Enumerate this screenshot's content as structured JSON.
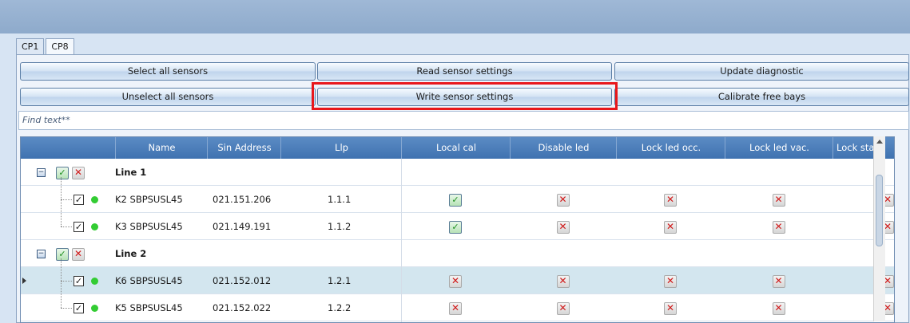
{
  "tabs": [
    {
      "label": "CP1",
      "active": false
    },
    {
      "label": "CP8",
      "active": true
    }
  ],
  "toolbar": {
    "select_all": "Select all sensors",
    "unselect_all": "Unselect all sensors",
    "read_settings": "Read sensor settings",
    "write_settings": "Write sensor settings",
    "update_diagnostic": "Update diagnostic",
    "calibrate": "Calibrate free bays"
  },
  "search": {
    "placeholder": "Find text**"
  },
  "columns": [
    "Name",
    "Sin Address",
    "Llp",
    "Local cal",
    "Disable led",
    "Lock led occ.",
    "Lock led vac.",
    "Lock stat"
  ],
  "groups": [
    {
      "label": "Line 1"
    },
    {
      "label": "Line 2"
    }
  ],
  "sensors": [
    {
      "name": "K2 SBPSUSL45",
      "address": "021.151.206",
      "llp": "1.1.1",
      "local_cal": true,
      "disable_led": false,
      "lock_led_occ": false,
      "lock_led_vac": false,
      "lock_stat": false
    },
    {
      "name": "K3 SBPSUSL45",
      "address": "021.149.191",
      "llp": "1.1.2",
      "local_cal": true,
      "disable_led": false,
      "lock_led_occ": false,
      "lock_led_vac": false,
      "lock_stat": false
    },
    {
      "name": "K6 SBPSUSL45",
      "address": "021.152.012",
      "llp": "1.2.1",
      "local_cal": false,
      "disable_led": false,
      "lock_led_occ": false,
      "lock_led_vac": false,
      "lock_stat": false
    },
    {
      "name": "K5 SBPSUSL45",
      "address": "021.152.022",
      "llp": "1.2.2",
      "local_cal": false,
      "disable_led": false,
      "lock_led_occ": false,
      "lock_led_vac": false,
      "lock_stat": false
    }
  ],
  "icons": {
    "ok": "check-icon",
    "no": "red-x-icon",
    "status": "green-dot-icon"
  },
  "colors": {
    "header": "#4a7ebb",
    "highlight": "#e8171b",
    "status_ok": "#33cc33",
    "selected_row": "#d3e6ef"
  }
}
